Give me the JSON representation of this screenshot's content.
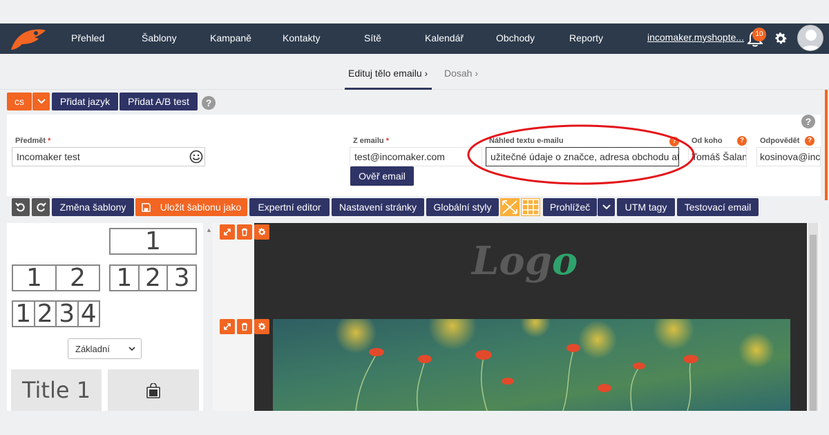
{
  "nav": {
    "items": [
      "Přehled",
      "Šablony",
      "Kampaně",
      "Kontakty",
      "Sítě",
      "Kalendář",
      "Obchody",
      "Reporty"
    ],
    "account": "incomaker.myshopte...",
    "notifications": "10"
  },
  "steps": {
    "current": "Edituj tělo emailu",
    "next": "Dosah"
  },
  "lang": {
    "current": "cs",
    "add_language": "Přidat jazyk",
    "add_ab_test": "Přidat A/B test"
  },
  "form": {
    "subject_label": "Předmět",
    "subject_value": "Incomaker test",
    "from_email_label": "Z emailu",
    "from_email_value": "test@incomaker.com",
    "verify_button": "Ověř email",
    "preview_label": "Náhled textu e-mailu",
    "preview_value": "užitečné údaje o značce, adresa obchodu atd.",
    "from_name_label": "Od koho",
    "from_name_value": "Tomáš Šalanda",
    "reply_label": "Odpovědět",
    "reply_value": "kosinova@incomaker.com",
    "required_mark": "*"
  },
  "toolbar": {
    "change_template": "Změna šablony",
    "save_template": "Uložit šablonu jako",
    "expert_editor": "Expertní editor",
    "page_settings": "Nastavení stránky",
    "global_styles": "Globální styly",
    "browser": "Prohlížeč",
    "utm_tags": "UTM tagy",
    "test_email": "Testovací email"
  },
  "blocks": {
    "grid1": [
      "1"
    ],
    "grid2": [
      "1",
      "2"
    ],
    "grid3": [
      "1",
      "2",
      "3"
    ],
    "grid4": [
      "1",
      "2",
      "3",
      "4"
    ],
    "style_select": "Základní",
    "title_tile": "Title 1"
  },
  "email": {
    "logo_main": "Log",
    "logo_accent": "o"
  },
  "colors": {
    "nav_bg": "#2c3a4c",
    "primary_navy": "#2f3466",
    "accent_orange": "#f26522",
    "logo_accent": "#2ea36b"
  }
}
